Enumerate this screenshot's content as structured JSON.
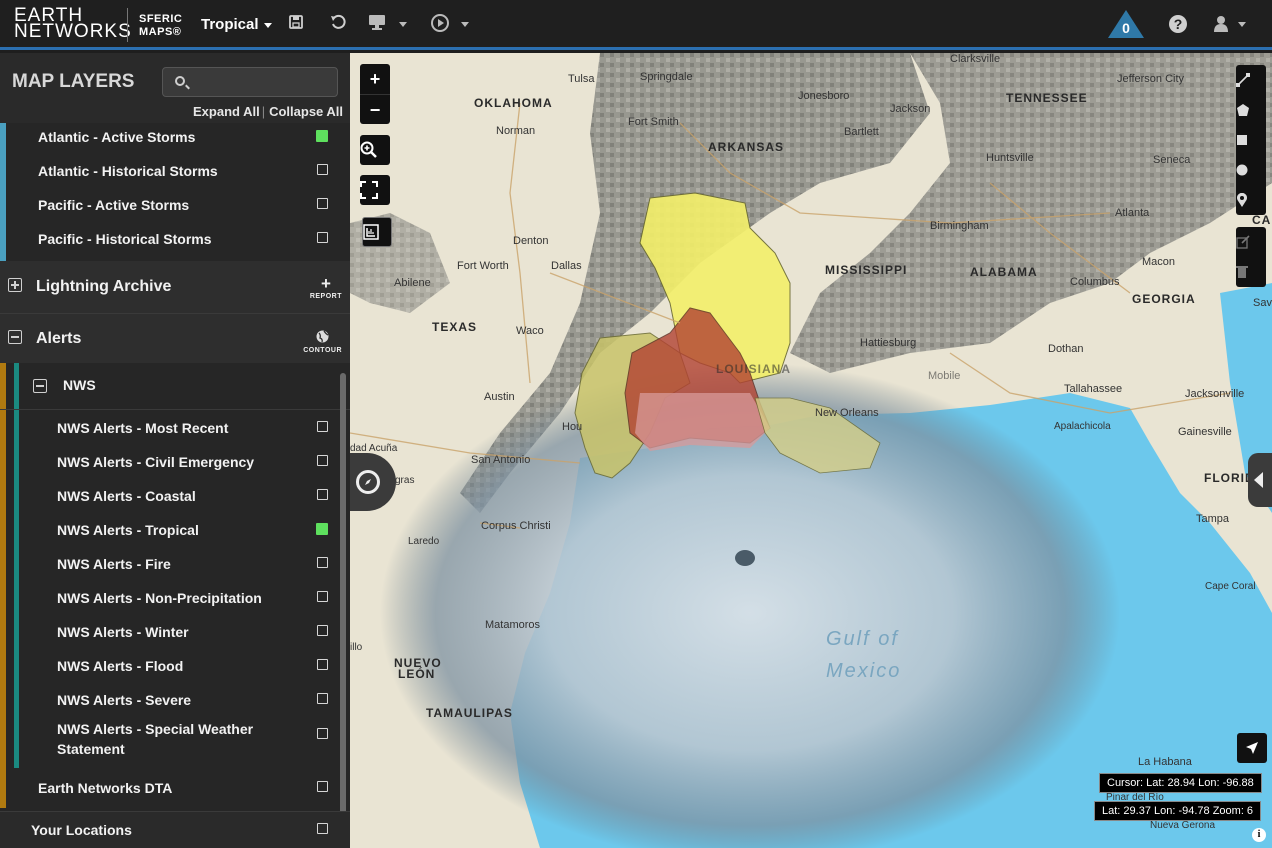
{
  "app": {
    "logo_line1": "EARTH",
    "logo_line2": "NETWORKS",
    "product_line1": "SFERIC",
    "product_line2": "MAPS®",
    "layout_name": "Tropical",
    "alert_count": "0"
  },
  "sidebar": {
    "title": "MAP LAYERS",
    "search_placeholder": "",
    "expand_all": "Expand All",
    "collapse_all": "Collapse All",
    "storm_layers": [
      {
        "label": "Atlantic - Active Storms",
        "checked": true
      },
      {
        "label": "Atlantic - Historical Storms",
        "checked": false
      },
      {
        "label": "Pacific - Active Storms",
        "checked": false
      },
      {
        "label": "Pacific - Historical Storms",
        "checked": false
      }
    ],
    "lightning_archive": {
      "label": "Lightning Archive",
      "action": "REPORT"
    },
    "alerts": {
      "label": "Alerts",
      "action": "CONTOUR"
    },
    "nws": {
      "label": "NWS"
    },
    "nws_layers": [
      {
        "label": "NWS Alerts - Most Recent",
        "checked": false
      },
      {
        "label": "NWS Alerts - Civil Emergency",
        "checked": false
      },
      {
        "label": "NWS Alerts - Coastal",
        "checked": false
      },
      {
        "label": "NWS Alerts - Tropical",
        "checked": true
      },
      {
        "label": "NWS Alerts - Fire",
        "checked": false
      },
      {
        "label": "NWS Alerts - Non-Precipitation",
        "checked": false
      },
      {
        "label": "NWS Alerts - Winter",
        "checked": false
      },
      {
        "label": "NWS Alerts - Flood",
        "checked": false
      },
      {
        "label": "NWS Alerts - Severe",
        "checked": false
      },
      {
        "label": "NWS Alerts - Special Weather Statement",
        "checked": false
      }
    ],
    "dta": {
      "label": "Earth Networks DTA",
      "checked": false
    },
    "your_locations": {
      "label": "Your Locations",
      "checked": false
    }
  },
  "map": {
    "zoom_in": "+",
    "zoom_out": "−",
    "states": [
      "OKLAHOMA",
      "ARKANSAS",
      "TENNESSEE",
      "MISSISSIPPI",
      "ALABAMA",
      "GEORGIA",
      "TEXAS",
      "LOUISIANA",
      "FLORIDA",
      "NUEVO",
      "LEÓN",
      "TAMAULIPAS",
      "CARO"
    ],
    "cities": [
      "Tulsa",
      "Springdale",
      "Fort Smith",
      "Jonesboro",
      "Jackson",
      "Clarksville",
      "Jefferson City",
      "Norman",
      "Bartlett",
      "Huntsville",
      "Seneca",
      "Atlanta",
      "Birmingham",
      "Denton",
      "Fort Worth",
      "Dallas",
      "Abilene",
      "Macon",
      "Columbus",
      "Savann",
      "Waco",
      "Hattiesburg",
      "Dothan",
      "Austin",
      "Mobile",
      "Tallahassee",
      "Jacksonville",
      "New Orleans",
      "Apalachicola",
      "Gainesville",
      "San Antonio",
      "Hou",
      "dad Acuña",
      "gras",
      "Corpus Christi",
      "Tampa",
      "Laredo",
      "Cape Coral",
      "Matamoros",
      "illo",
      "La Habana",
      "Pinar del Río",
      "Nueva Gerona"
    ],
    "sea_label_1": "Gulf of",
    "sea_label_2": "Mexico",
    "cursor_readout": "Cursor: Lat: 28.94 Lon: -96.88",
    "center_readout": "Lat: 29.37 Lon: -94.78 Zoom: 6"
  },
  "colors": {
    "accent": "#2b6fb0",
    "checked": "#5ee05e",
    "ocean": "#6cc8ec",
    "land": "#e9e4d3",
    "tropical_warning_yellow": "#f4f06a",
    "hurricane_warning_red": "#c0392b"
  }
}
